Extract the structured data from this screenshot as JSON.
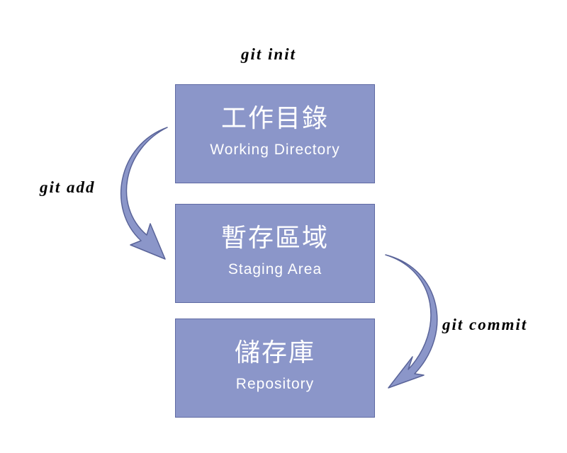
{
  "commands": {
    "init": "git init",
    "add": "git add",
    "commit": "git commit"
  },
  "stages": [
    {
      "zh": "工作目錄",
      "en": "Working Directory"
    },
    {
      "zh": "暫存區域",
      "en": "Staging Area"
    },
    {
      "zh": "儲存庫",
      "en": "Repository"
    }
  ],
  "colors": {
    "box_fill": "#8b96c9",
    "box_border": "#5f6aa3",
    "arrow_fill": "#8b96c9",
    "arrow_stroke": "#5a6499",
    "text_on_box": "#ffffff"
  }
}
